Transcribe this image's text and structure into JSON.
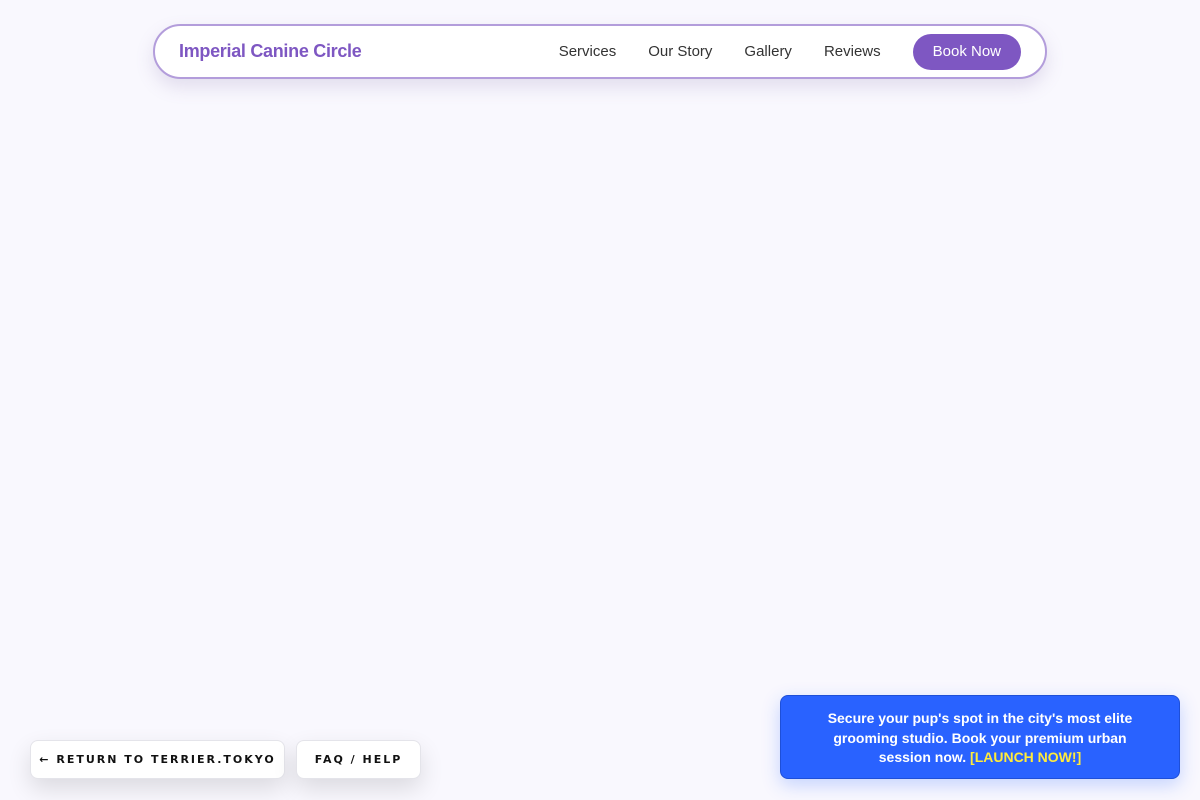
{
  "header": {
    "brand": "Imperial Canine Circle",
    "nav": [
      "Services",
      "Our Story",
      "Gallery",
      "Reviews"
    ],
    "cta": "Book Now"
  },
  "bottom_buttons": {
    "return_label": "← RETURN TO TERRIER.TOKYO",
    "faq_label": "FAQ / HELP"
  },
  "promo": {
    "text": "Secure your pup's spot in the city's most elite grooming studio. Book your premium urban session now.",
    "link": "[LAUNCH NOW!]"
  },
  "colors": {
    "accent": "#7e57c2",
    "background": "#f9f8fe",
    "promo_bg": "#2962ff",
    "promo_link": "#ffeb3b"
  }
}
